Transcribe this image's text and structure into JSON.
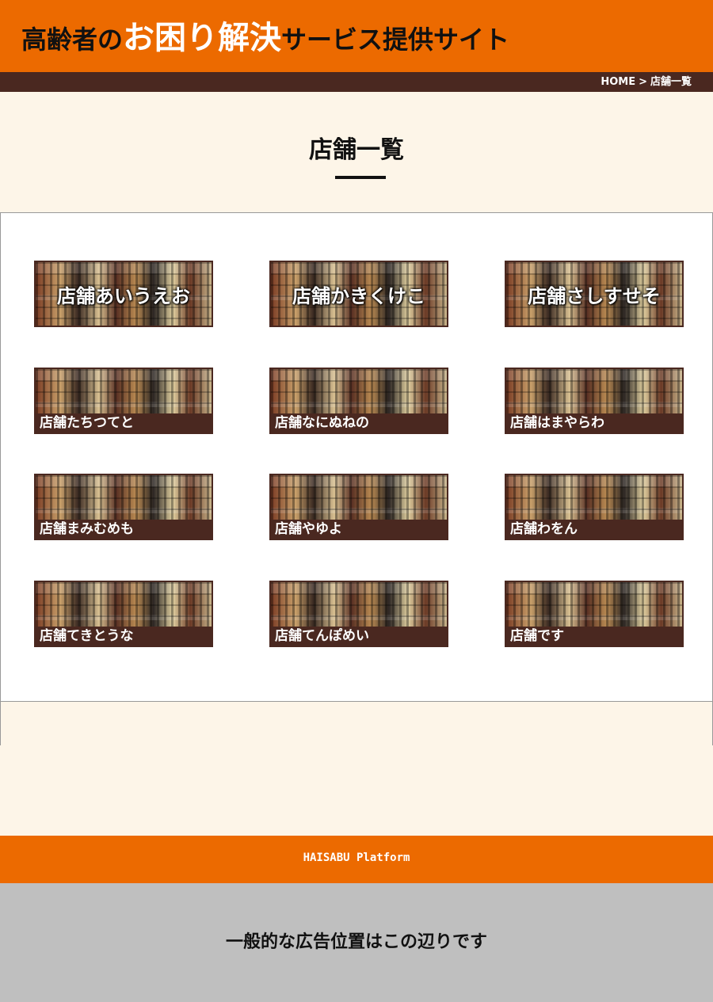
{
  "header": {
    "title_part1": "高齢者の",
    "title_part2": "お困り解決",
    "title_part3": "サービス提供サイト"
  },
  "breadcrumb": {
    "home": "HOME",
    "separator": ">",
    "current": "店舗一覧"
  },
  "page": {
    "title": "店舗一覧"
  },
  "stores": [
    {
      "name": "店舗あいうえお"
    },
    {
      "name": "店舗かきくけこ"
    },
    {
      "name": "店舗さしすせそ"
    },
    {
      "name": "店舗たちつてと"
    },
    {
      "name": "店舗なにぬねの"
    },
    {
      "name": "店舗はまやらわ"
    },
    {
      "name": "店舗まみむめも"
    },
    {
      "name": "店舗やゆよ"
    },
    {
      "name": "店舗わをん"
    },
    {
      "name": "店舗てきとうな"
    },
    {
      "name": "店舗てんぽめい"
    },
    {
      "name": "店舗です"
    }
  ],
  "footer": {
    "text": "HAISABU Platform"
  },
  "ad": {
    "text": "一般的な広告位置はこの辺りです"
  },
  "colors": {
    "accent": "#ec6a00",
    "dark": "#4a2820",
    "background": "#fdf5e8",
    "ad_background": "#bfbfbf"
  }
}
